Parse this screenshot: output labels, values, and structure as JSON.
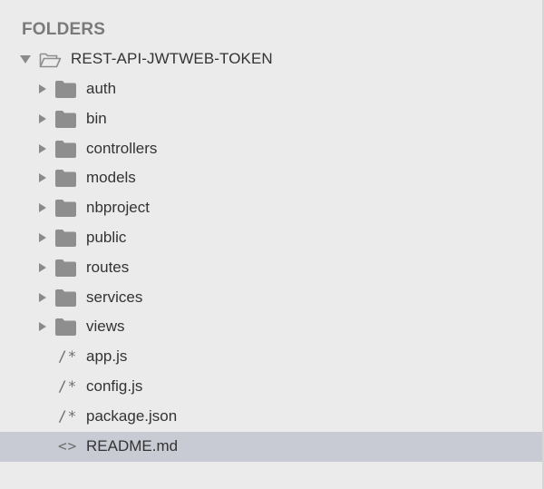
{
  "sidebar": {
    "header": "FOLDERS",
    "root": {
      "name": "REST-API-JWTWEB-TOKEN",
      "icon": "open-folder-icon",
      "expanded": true
    },
    "folders": [
      {
        "name": "auth"
      },
      {
        "name": "bin"
      },
      {
        "name": "controllers"
      },
      {
        "name": "models"
      },
      {
        "name": "nbproject"
      },
      {
        "name": "public"
      },
      {
        "name": "routes"
      },
      {
        "name": "services"
      },
      {
        "name": "views"
      }
    ],
    "files": [
      {
        "name": "app.js",
        "glyph": "/*",
        "icon": "comment-icon"
      },
      {
        "name": "config.js",
        "glyph": "/*",
        "icon": "comment-icon"
      },
      {
        "name": "package.json",
        "glyph": "/*",
        "icon": "comment-icon"
      },
      {
        "name": "README.md",
        "glyph": "<>",
        "icon": "code-brackets-icon",
        "selected": true
      }
    ]
  },
  "colors": {
    "background": "#ebebeb",
    "selected_row": "#c8cbd3",
    "folder_icon": "#8e8e8e",
    "text": "#333333",
    "header_text": "#7a7a7a"
  }
}
